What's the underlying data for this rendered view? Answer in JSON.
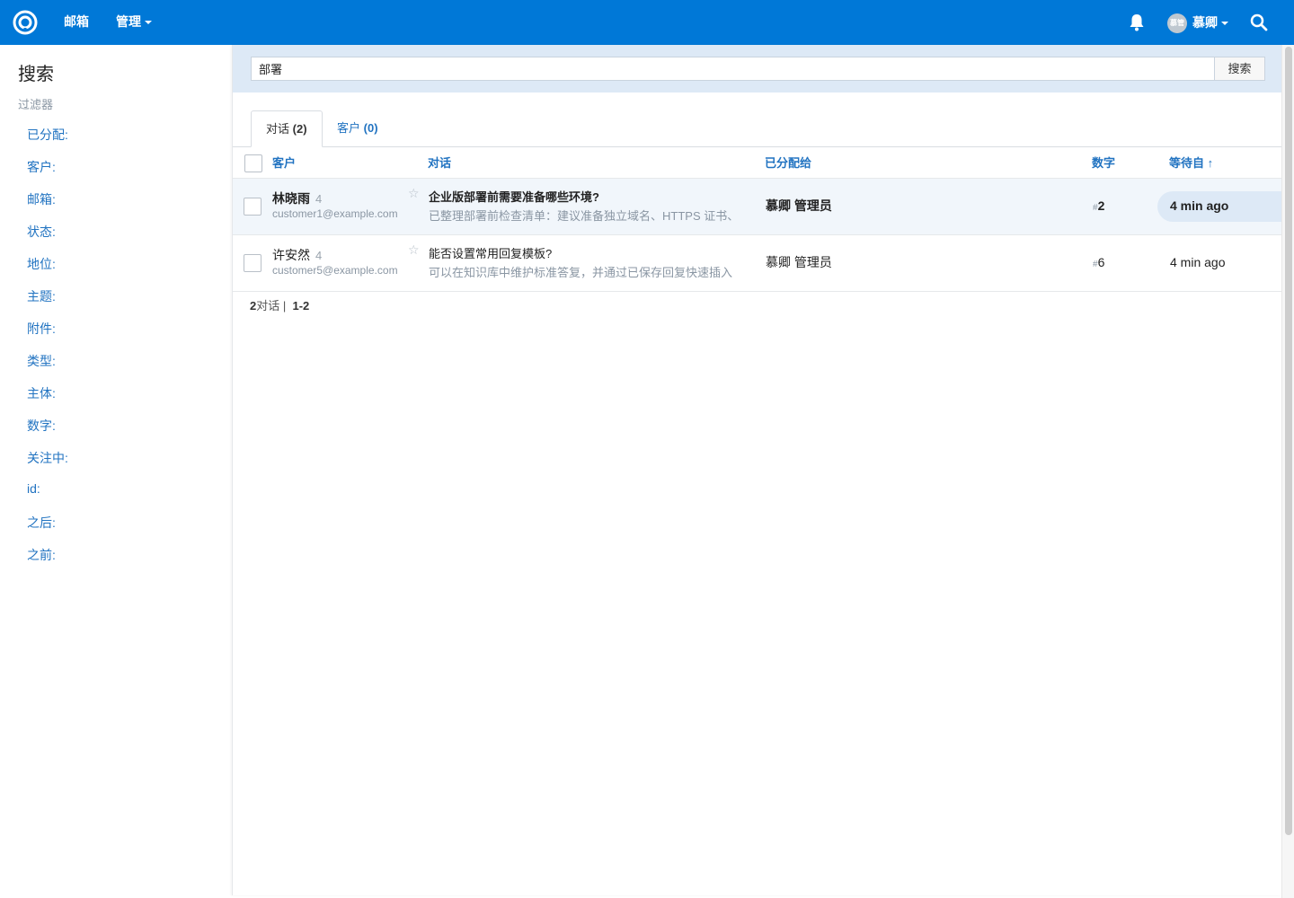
{
  "topnav": {
    "mailbox_label": "邮箱",
    "manage_label": "管理",
    "user_name": "慕卿",
    "avatar_text": "慕管"
  },
  "sidebar": {
    "title": "搜索",
    "filters_label": "过滤器",
    "items": [
      {
        "label": "已分配:"
      },
      {
        "label": "客户:"
      },
      {
        "label": "邮箱:"
      },
      {
        "label": "状态:"
      },
      {
        "label": "地位:"
      },
      {
        "label": "主题:"
      },
      {
        "label": "附件:"
      },
      {
        "label": "类型:"
      },
      {
        "label": "主体:"
      },
      {
        "label": "数字:"
      },
      {
        "label": "关注中:"
      },
      {
        "label": "id:"
      },
      {
        "label": "之后:"
      },
      {
        "label": "之前:"
      }
    ]
  },
  "search": {
    "value": "部署",
    "button_label": "搜索"
  },
  "tabs": [
    {
      "label": "对话",
      "count": "(2)"
    },
    {
      "label": "客户",
      "count": "(0)"
    }
  ],
  "table": {
    "headers": {
      "customer": "客户",
      "conversation": "对话",
      "assigned_to": "已分配给",
      "number": "数字",
      "waiting_since": "等待自 ↑"
    },
    "rows": [
      {
        "customer_name": "林晓雨",
        "customer_count": "4",
        "customer_email": "customer1@example.com",
        "subject": "企业版部署前需要准备哪些环境?",
        "preview": "已整理部署前检查清单：建议准备独立域名、HTTPS 证书、",
        "assignee": "慕卿 管理员",
        "hash": "#",
        "number": "2",
        "waiting": "4 min ago"
      },
      {
        "customer_name": "许安然",
        "customer_count": "4",
        "customer_email": "customer5@example.com",
        "subject": "能否设置常用回复模板?",
        "preview": "可以在知识库中维护标准答复，并通过已保存回复快速插入",
        "assignee": "慕卿 管理员",
        "hash": "#",
        "number": "6",
        "waiting": "4 min ago"
      }
    ]
  },
  "footer": {
    "total": "2",
    "total_label": "对话",
    "separator": "|",
    "range": "1-2"
  },
  "colors": {
    "topbar": "#0078d7",
    "link": "#2173c1",
    "search_band": "#dde9f6",
    "selected_row": "#f1f6fb"
  }
}
